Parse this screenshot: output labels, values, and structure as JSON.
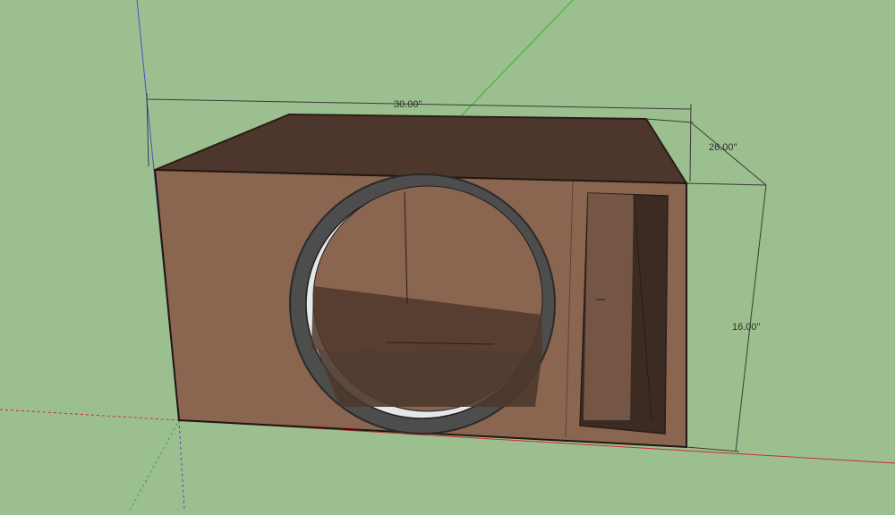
{
  "dimensions": {
    "width_label": "30.00\"",
    "depth_label": "26.00\"",
    "height_label": "16.00\""
  },
  "colors": {
    "background": "#9bbf8e",
    "enclosure_front": "#8a6550",
    "enclosure_top": "#4d372c",
    "enclosure_dark": "#3b2b22",
    "port_ring": "#4a4a4a",
    "axis_red": "#d12c2c",
    "axis_green": "#2fb12f",
    "axis_blue": "#3e55c9"
  }
}
